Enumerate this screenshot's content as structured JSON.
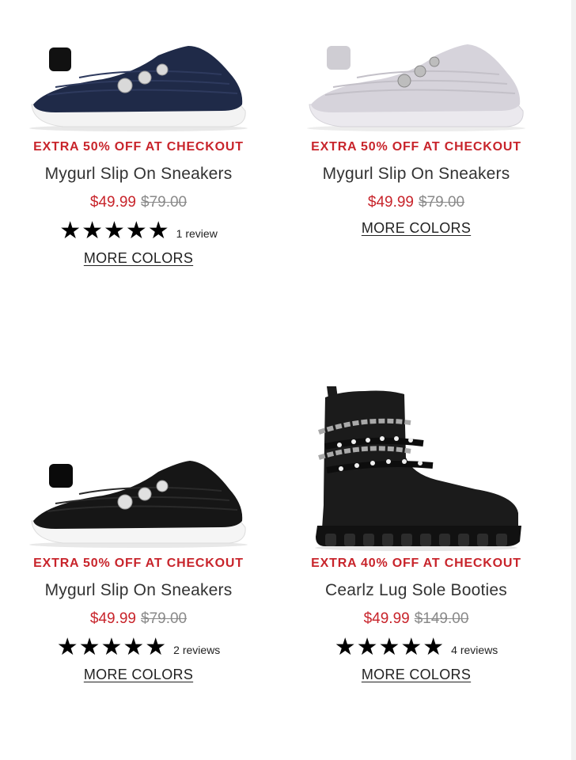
{
  "products": [
    {
      "image_label": "navy slip-on sneaker with jewel accents",
      "promo": "EXTRA 50% OFF AT CHECKOUT",
      "title": "Mygurl Slip On Sneakers",
      "sale_price": "$49.99",
      "original_price": "$79.00",
      "stars": "★★★★★",
      "rating": 5,
      "review_count": "1 review",
      "more_colors": "MORE COLORS",
      "colors": {
        "upper": "#1f2a48",
        "sole": "#f3f3f3"
      }
    },
    {
      "image_label": "light gray slip-on sneaker with jewel accents",
      "promo": "EXTRA 50% OFF AT CHECKOUT",
      "title": "Mygurl Slip On Sneakers",
      "sale_price": "$49.99",
      "original_price": "$79.00",
      "more_colors": "MORE COLORS",
      "colors": {
        "upper": "#d6d3db",
        "sole": "#ebe9ee"
      }
    },
    {
      "image_label": "black slip-on sneaker with jewel accents",
      "promo": "EXTRA 50% OFF AT CHECKOUT",
      "title": "Mygurl Slip On Sneakers",
      "sale_price": "$49.99",
      "original_price": "$79.00",
      "stars": "★★★★★",
      "rating": 5,
      "review_count": "2 reviews",
      "more_colors": "MORE COLORS",
      "colors": {
        "upper": "#161616",
        "sole": "#f5f5f5"
      }
    },
    {
      "image_label": "black lug sole bootie with chains and pearl straps",
      "promo": "EXTRA 40% OFF AT CHECKOUT",
      "title": "Cearlz Lug Sole Booties",
      "sale_price": "$49.99",
      "original_price": "$149.00",
      "stars": "★★★★★",
      "rating": 5,
      "review_count": "4 reviews",
      "more_colors": "MORE COLORS",
      "colors": {
        "upper": "#1b1b1b",
        "sole": "#111111"
      }
    }
  ],
  "theme": {
    "promo_color": "#c8242b",
    "sale_color": "#c8242b",
    "strike_color": "#8a8a8a"
  }
}
